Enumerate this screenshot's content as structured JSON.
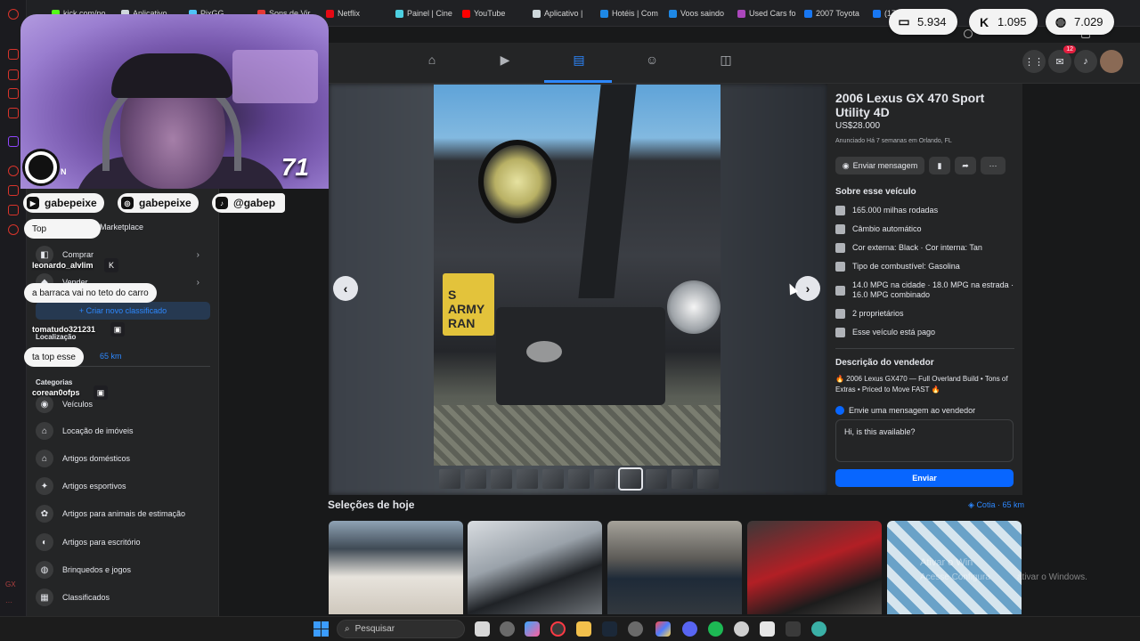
{
  "browser": {
    "tabs": [
      {
        "label": "kick.com/po",
        "color": "#53fc18"
      },
      {
        "label": "Aplicativo",
        "color": "#cfd8dc"
      },
      {
        "label": "PixGG",
        "color": "#4fc3f7"
      },
      {
        "label": "Sons de Vir",
        "color": "#e53935"
      },
      {
        "label": "Netflix",
        "color": "#e50914"
      },
      {
        "label": "Painel | Cine",
        "color": "#4dd0e1"
      },
      {
        "label": "YouTube",
        "color": "#ff0000"
      },
      {
        "label": "Aplicativo |",
        "color": "#cfd8dc"
      },
      {
        "label": "Hotéis | Com",
        "color": "#1e88e5"
      },
      {
        "label": "Voos saindo",
        "color": "#1e88e5"
      },
      {
        "label": "Used Cars fo",
        "color": "#ab47bc"
      },
      {
        "label": "2007 Toyota",
        "color": "#1877f2"
      },
      {
        "label": "(17) Faceb",
        "color": "#1877f2"
      }
    ]
  },
  "stream": {
    "counters": [
      {
        "icon": "chat-bubble-icon",
        "value": "5.934"
      },
      {
        "icon": "kick-k-icon",
        "value": "1.095"
      },
      {
        "icon": "globe-icon",
        "value": "7.029"
      }
    ],
    "cam_number": "71",
    "logo_initial": "N",
    "socials": [
      {
        "icon": "youtube-icon",
        "glyph": "▶",
        "handle": "gabepeixe"
      },
      {
        "icon": "instagram-icon",
        "glyph": "◎",
        "handle": "gabepeixe"
      },
      {
        "icon": "tiktok-icon",
        "glyph": "♪",
        "handle": "@gabep"
      }
    ],
    "chat": [
      {
        "user": "",
        "message": "Top"
      },
      {
        "user": "leonardo_alvlim",
        "badge": "K",
        "message": "a barraca vai no teto do carro"
      },
      {
        "user": "tomatudo321231",
        "badge": "▣",
        "message": "ta top esse"
      },
      {
        "user": "corean0ofps",
        "badge": "▣",
        "message": ""
      }
    ]
  },
  "fb_nav": {
    "items": [
      {
        "name": "home-icon",
        "glyph": "⌂"
      },
      {
        "name": "video-icon",
        "glyph": "▶"
      },
      {
        "name": "marketplace-icon",
        "glyph": "▤"
      },
      {
        "name": "groups-icon",
        "glyph": "☺"
      },
      {
        "name": "gaming-icon",
        "glyph": "◫"
      }
    ],
    "messenger_badge": "12"
  },
  "sidebar": {
    "title": "Marketplace",
    "rows": [
      {
        "label": "Comprar",
        "icon": "shopping-bag-icon",
        "glyph": "◧"
      },
      {
        "label": "Vender",
        "icon": "tag-icon",
        "glyph": "◆"
      }
    ],
    "create_button": "+ Criar novo classificado",
    "location_label": "Localização",
    "location_value": "65 km",
    "categories_title": "Categorias",
    "categories": [
      {
        "label": "Veículos",
        "glyph": "◉"
      },
      {
        "label": "Locação de imóveis",
        "glyph": "⌂"
      },
      {
        "label": "Artigos domésticos",
        "glyph": "⌂"
      },
      {
        "label": "Artigos esportivos",
        "glyph": "✦"
      },
      {
        "label": "Artigos para animais de estimação",
        "glyph": "✿"
      },
      {
        "label": "Artigos para escritório",
        "glyph": "◐"
      },
      {
        "label": "Brinquedos e jogos",
        "glyph": "◍"
      },
      {
        "label": "Classificados",
        "glyph": "▦"
      }
    ]
  },
  "listing": {
    "title": "2006 Lexus GX 470 Sport Utility 4D",
    "price": "US$28.000",
    "listed": "Anunciado Há 7 semanas em Orlando, FL",
    "message_button": "Enviar mensagem",
    "about_title": "Sobre esse veículo",
    "specs": [
      {
        "icon": "speedometer-icon",
        "text": "165.000 milhas rodadas"
      },
      {
        "icon": "transmission-icon",
        "text": "Câmbio automático"
      },
      {
        "icon": "paint-icon",
        "text": "Cor externa: Black · Cor interna: Tan"
      },
      {
        "icon": "fuel-icon",
        "text": "Tipo de combustível: Gasolina"
      },
      {
        "icon": "mpg-icon",
        "text": "14.0 MPG na cidade · 18.0 MPG na estrada · 16.0 MPG combinado"
      },
      {
        "icon": "owners-icon",
        "text": "2 proprietários"
      },
      {
        "icon": "paid-icon",
        "text": "Esse veículo está pago"
      }
    ],
    "seller_desc_title": "Descrição do vendedor",
    "seller_desc": "🔥 2006 Lexus GX470 — Full Overland Build • Tons of Extras • Priced to Move FAST 🔥",
    "send_prompt": "Envie uma mensagem ao vendedor",
    "message_text": "Hi, is this available?",
    "send_button": "Enviar",
    "photo_plate": "S ARMY\nRAN"
  },
  "picks": {
    "title": "Seleções de hoje",
    "location": "Cotia · 65 km"
  },
  "windows": {
    "activate_1": "Ativar o Win",
    "activate_2": "Acesse Configura",
    "activate_3": "ativar o Windows.",
    "search_placeholder": "Pesquisar"
  }
}
